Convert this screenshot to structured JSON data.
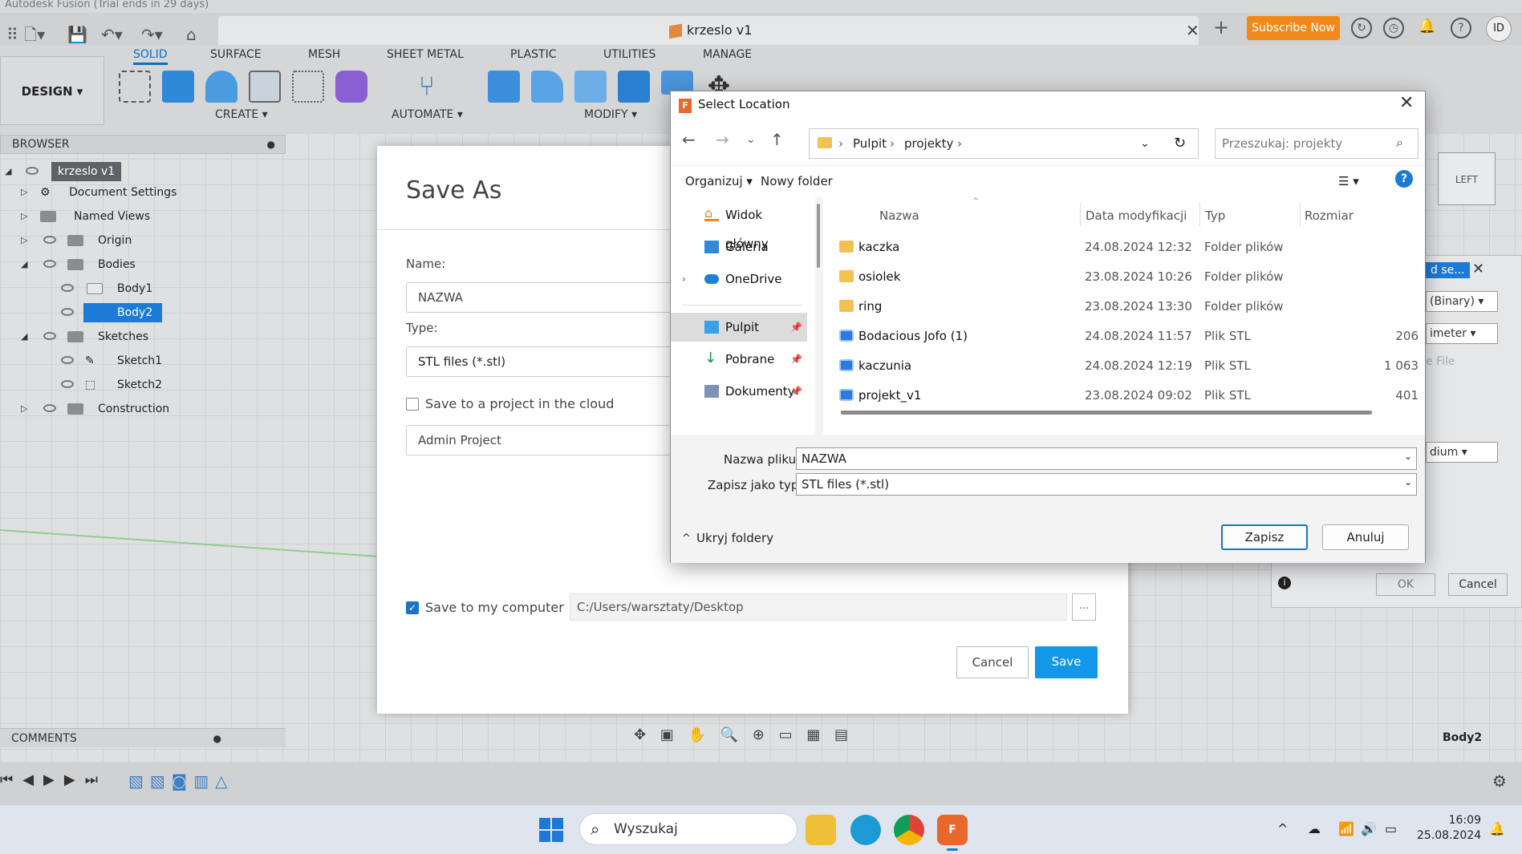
{
  "app": {
    "titlebar": "Autodesk Fusion (Trial ends in 29 days)",
    "doc_tab": "krzeslo v1",
    "subscribe": "Subscribe Now",
    "avatar": "ID"
  },
  "ribbon": {
    "workspace": "DESIGN ▾",
    "tabs": [
      "SOLID",
      "SURFACE",
      "MESH",
      "SHEET METAL",
      "PLASTIC",
      "UTILITIES",
      "MANAGE"
    ],
    "groups": {
      "create": "CREATE ▾",
      "automate": "AUTOMATE ▾",
      "modify": "MODIFY ▾"
    }
  },
  "browser": {
    "title": "BROWSER",
    "root": "krzeslo v1",
    "items": [
      "Document Settings",
      "Named Views",
      "Origin",
      "Bodies",
      "Body1",
      "Body2",
      "Sketches",
      "Sketch1",
      "Sketch2",
      "Construction"
    ]
  },
  "comments": "COMMENTS",
  "status": {
    "body_label": "Body2"
  },
  "viewcube": {
    "face": "LEFT"
  },
  "right_panel": {
    "format": "(Binary) ▾",
    "unit": "imeter ▾",
    "file": "e File",
    "refinement": "dium ▾",
    "ok": "OK",
    "cancel": "Cancel",
    "tab": "d se..."
  },
  "save_as": {
    "title": "Save As",
    "name_label": "Name:",
    "name_value": "NAZWA",
    "type_label": "Type:",
    "type_value": "STL files (*.stl)",
    "cloud_label": "Save to a project in the cloud",
    "project": "Admin Project",
    "computer_label": "Save to my computer",
    "path": "C:/Users/warsztaty/Desktop",
    "browse": "...",
    "cancel": "Cancel",
    "save": "Save"
  },
  "file_dialog": {
    "title": "Select Location",
    "breadcrumb": [
      "Pulpit",
      "projekty"
    ],
    "search_placeholder": "Przeszukaj: projekty",
    "organize": "Organizuj ▾",
    "new_folder": "Nowy folder",
    "nav": [
      {
        "label": "Widok główny",
        "icon": "home-icon"
      },
      {
        "label": "Galeria",
        "icon": "gallery-icon"
      },
      {
        "label": "OneDrive",
        "icon": "cloud-icon"
      },
      {
        "label": "Pulpit",
        "icon": "desktop-icon"
      },
      {
        "label": "Pobrane",
        "icon": "download-icon"
      },
      {
        "label": "Dokumenty",
        "icon": "document-icon"
      }
    ],
    "columns": {
      "name": "Nazwa",
      "date": "Data modyfikacji",
      "type": "Typ",
      "size": "Rozmiar"
    },
    "files": [
      {
        "name": "kaczka",
        "date": "24.08.2024 12:32",
        "type": "Folder plików",
        "size": "",
        "kind": "folder"
      },
      {
        "name": "osiolek",
        "date": "23.08.2024 10:26",
        "type": "Folder plików",
        "size": "",
        "kind": "folder"
      },
      {
        "name": "ring",
        "date": "23.08.2024 13:30",
        "type": "Folder plików",
        "size": "",
        "kind": "folder"
      },
      {
        "name": "Bodacious Jofo (1)",
        "date": "24.08.2024 11:57",
        "type": "Plik STL",
        "size": "206",
        "kind": "stl"
      },
      {
        "name": "kaczunia",
        "date": "24.08.2024 12:19",
        "type": "Plik STL",
        "size": "1 063",
        "kind": "stl"
      },
      {
        "name": "projekt_v1",
        "date": "23.08.2024 09:02",
        "type": "Plik STL",
        "size": "401",
        "kind": "stl"
      }
    ],
    "filename_label": "Nazwa pliku:",
    "filename_value": "NAZWA",
    "savetype_label": "Zapisz jako typ:",
    "savetype_value": "STL files (*.stl)",
    "hide_folders": "Ukryj foldery",
    "save_btn": "Zapisz",
    "cancel_btn": "Anuluj"
  },
  "taskbar": {
    "search": "Wyszukaj",
    "time": "16:09",
    "date": "25.08.2024"
  }
}
